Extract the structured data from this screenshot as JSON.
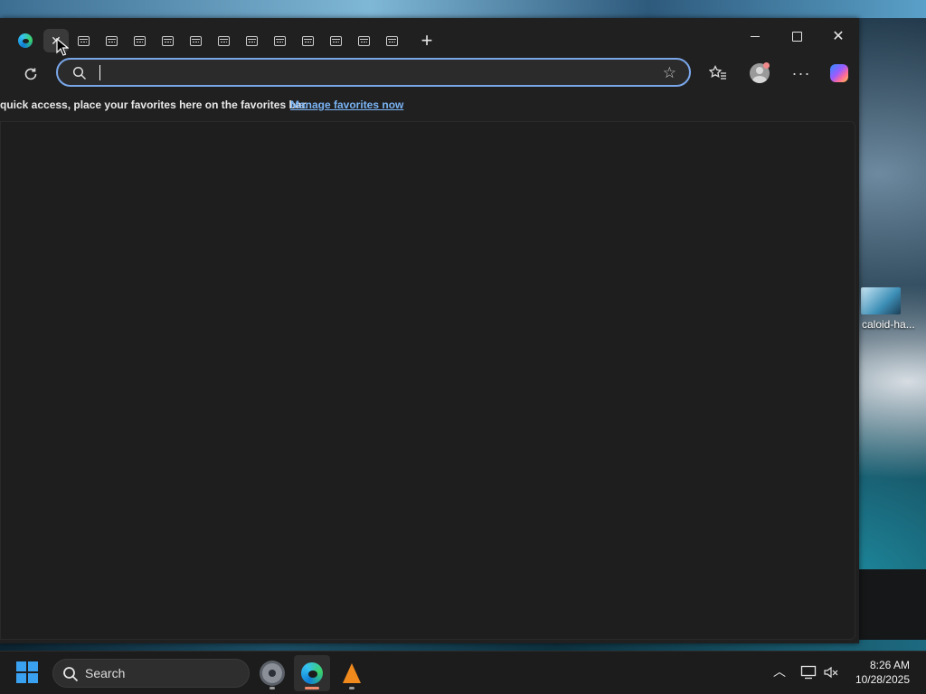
{
  "desktop": {
    "icon_label": "caloid-ha..."
  },
  "browser": {
    "tabs": [
      {
        "icon": "edge-icon"
      },
      {
        "icon": "close-icon",
        "active": true
      },
      {
        "icon": "page-icon"
      },
      {
        "icon": "page-icon"
      },
      {
        "icon": "page-icon"
      },
      {
        "icon": "page-icon"
      },
      {
        "icon": "page-icon"
      },
      {
        "icon": "page-icon"
      },
      {
        "icon": "page-icon"
      },
      {
        "icon": "page-icon"
      },
      {
        "icon": "page-icon"
      },
      {
        "icon": "page-icon"
      },
      {
        "icon": "page-icon"
      },
      {
        "icon": "page-icon"
      }
    ],
    "new_tab_label": "+",
    "window_controls": {
      "close_label": "✕"
    },
    "address_bar": {
      "value": "",
      "placeholder": ""
    },
    "favorites_bar": {
      "message": "quick access, place your favorites here on the favorites bar.",
      "link_text": "Manage favorites now"
    },
    "accent_color": "#7aa7ea"
  },
  "taskbar": {
    "search_label": "Search",
    "clock": {
      "time": "8:26 AM",
      "date": "10/28/2025"
    }
  }
}
